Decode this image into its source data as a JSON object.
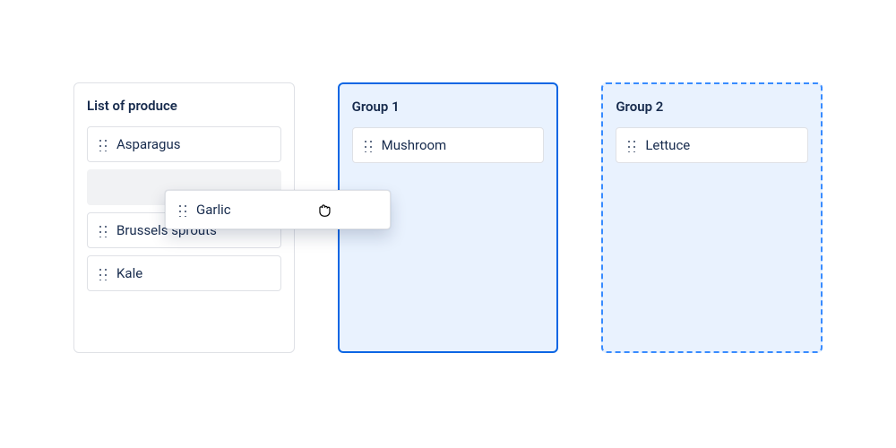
{
  "source": {
    "title": "List of produce",
    "items": [
      "Asparagus",
      "Brussels sprouts",
      "Kale"
    ]
  },
  "group1": {
    "title": "Group 1",
    "items": [
      "Mushroom"
    ]
  },
  "group2": {
    "title": "Group 2",
    "items": [
      "Lettuce"
    ]
  },
  "dragging": {
    "label": "Garlic"
  }
}
